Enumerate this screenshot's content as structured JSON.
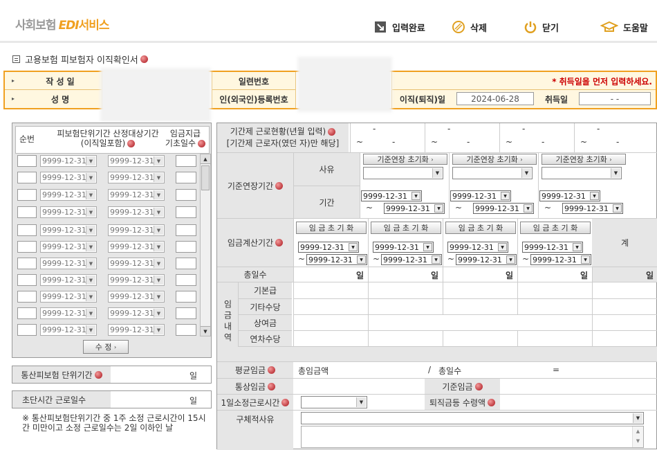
{
  "app": {
    "logo_main": "사회보험",
    "logo_edi": "EDI",
    "logo_svc": "서비스"
  },
  "toolbar": {
    "complete": "입력완료",
    "delete": "삭제",
    "close": "닫기",
    "help": "도움말"
  },
  "page": {
    "title": "고용보험 피보험자 이직확인서"
  },
  "header": {
    "write_date": "작 성 일",
    "serial_no": "일련번호",
    "warning": "* 취득일을 먼저 입력하세요.",
    "name": "성   명",
    "reg_no": "인(외국인)등록번호",
    "leave_date_label": "이직(퇴직)일",
    "leave_date_value": "2024-06-28",
    "acquire_label": "취득일",
    "acquire_value": "-    -"
  },
  "left": {
    "col_no": "순번",
    "col_period": "피보험단위기간 산정대상기간",
    "col_period_sub": "(이직일포함)",
    "col_wage": "임금지급",
    "col_wage_sub": "기초일수",
    "date_default": "9999-12-31",
    "edit_btn": "수   정",
    "total_unit_label": "통산피보험 단위기간",
    "day": "일",
    "short_work_label": "초단시간 근로일수",
    "note": "※ 통산피보험단위기간 중 1주 소정 근로시간이 15시간 미만이고 소정 근로일수는 2일 이하인 날"
  },
  "right": {
    "contract_label": "기간제 근로현황(년월 입력)",
    "contract_sub": "[기간제 근로자(였던 자)만 해당]",
    "dash": "-",
    "tilde": "~",
    "extend_label": "기준연장기간",
    "reason": "사유",
    "period": "기간",
    "extend_reset": "기준연장 초기화",
    "wage_calc_label": "임금계산기간",
    "wage_reset": "임 금 초 기 화",
    "total": "계",
    "total_days": "총일수",
    "day": "일",
    "wage_detail": "임금내역",
    "base_pay": "기본급",
    "other_allow": "기타수당",
    "bonus": "상여금",
    "annual_allow": "연차수당",
    "avg_wage": "평균임금",
    "total_wage": "총임금액",
    "slash": "/",
    "total_days2": "총일수",
    "equals": "=",
    "normal_wage": "통상임금",
    "base_wage": "기준임금",
    "daily_hours": "1일소정근로시간",
    "retire_amount": "퇴직금등 수령액",
    "specific_reason": "구체적사유"
  },
  "colors": {
    "accent": "#f0a020",
    "header_bg": "#fff7e0",
    "panel_gray": "#e6e6e6",
    "warning_red": "#cc0000"
  },
  "icons": [
    "check-box-icon",
    "trash-icon",
    "power-icon",
    "graduation-cap-icon",
    "help-dot-icon",
    "form-icon"
  ]
}
